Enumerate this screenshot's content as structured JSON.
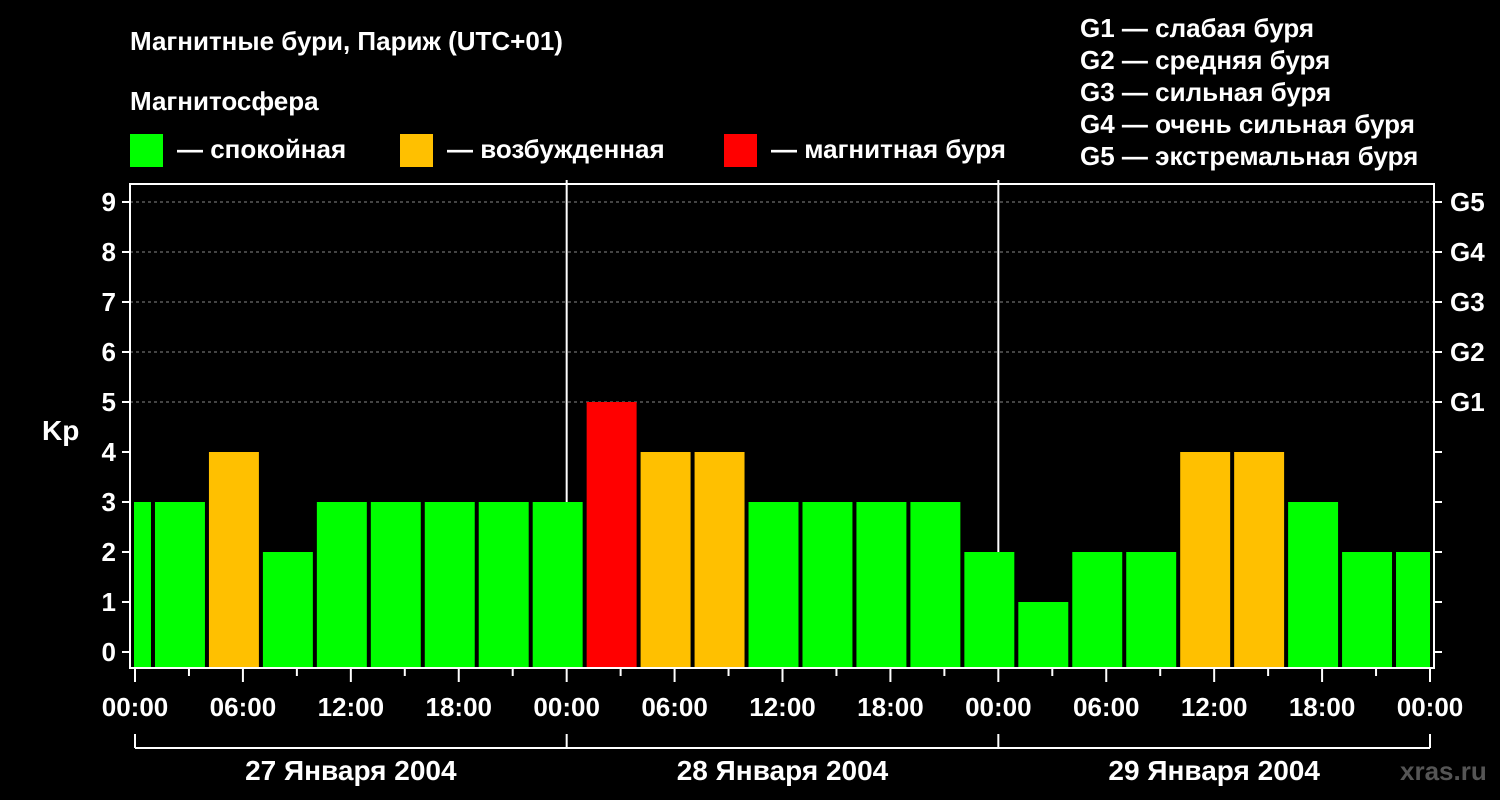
{
  "header": {
    "title": "Магнитные бури, Париж (UTC+01)",
    "subtitle": "Магнитосфера",
    "watermark": "xras.ru"
  },
  "legend": {
    "states": [
      {
        "label": "— спокойная",
        "color": "#00ff00"
      },
      {
        "label": "— возбужденная",
        "color": "#ffc000"
      },
      {
        "label": "— магнитная буря",
        "color": "#ff0000"
      }
    ],
    "g_scale": [
      "G1 — слабая буря",
      "G2 — средняя буря",
      "G3 — сильная буря",
      "G4 — очень сильная буря",
      "G5 — экстремальная буря"
    ]
  },
  "chart_data": {
    "type": "bar",
    "ylabel": "Kp",
    "ylim": [
      0,
      9
    ],
    "y_ticks": [
      "0",
      "1",
      "2",
      "3",
      "4",
      "5",
      "6",
      "7",
      "8",
      "9"
    ],
    "g_ticks": [
      {
        "kp": 5,
        "label": "G1"
      },
      {
        "kp": 6,
        "label": "G2"
      },
      {
        "kp": 7,
        "label": "G3"
      },
      {
        "kp": 8,
        "label": "G4"
      },
      {
        "kp": 9,
        "label": "G5"
      }
    ],
    "x_ticks": [
      "00:00",
      "06:00",
      "12:00",
      "18:00",
      "00:00",
      "06:00",
      "12:00",
      "18:00",
      "00:00",
      "06:00",
      "12:00",
      "18:00",
      "00:00"
    ],
    "dates": [
      "27 Января 2004",
      "28 Января 2004",
      "29 Января 2004"
    ],
    "x_start_hour": 0,
    "x_end_hour": 72,
    "bar_hours": 3,
    "bar_start_hours": [
      -2,
      1,
      4,
      7,
      10,
      13,
      16,
      19,
      22,
      25,
      28,
      31,
      34,
      37,
      40,
      43,
      46,
      49,
      52,
      55,
      58,
      61,
      64,
      67,
      70
    ],
    "values": [
      3,
      3,
      4,
      2,
      3,
      3,
      3,
      3,
      3,
      5,
      4,
      4,
      3,
      3,
      3,
      3,
      2,
      1,
      2,
      2,
      4,
      4,
      3,
      2,
      2
    ],
    "colors": {
      "quiet": "#00ff00",
      "active": "#ffc000",
      "storm": "#ff0000"
    },
    "grid": true
  }
}
